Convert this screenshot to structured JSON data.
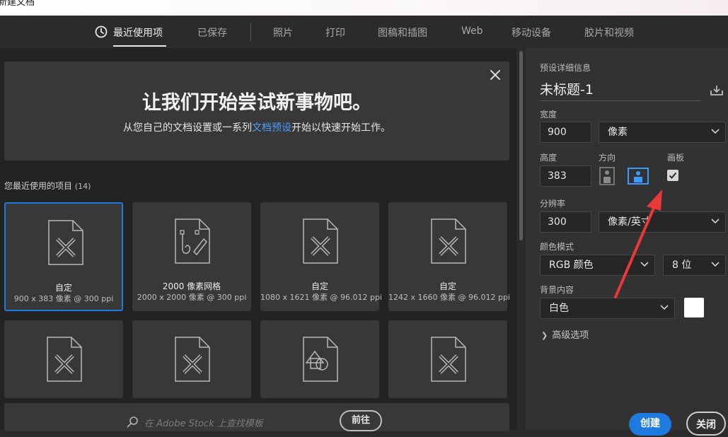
{
  "window": {
    "title": "新建文档"
  },
  "tabs": [
    {
      "label": "最近使用项",
      "active": true
    },
    {
      "label": "已保存"
    },
    {
      "label": "照片"
    },
    {
      "label": "打印"
    },
    {
      "label": "图稿和插图"
    },
    {
      "label": "Web"
    },
    {
      "label": "移动设备"
    },
    {
      "label": "胶片和视频"
    }
  ],
  "banner": {
    "title": "让我们开始尝试新事物吧。",
    "sub_before": "从您自己的文档设置或一系列",
    "sub_link": "文档预设",
    "sub_after": "开始以快速开始工作。"
  },
  "recent": {
    "label": "您最近使用的项目",
    "count": "(14)",
    "items": [
      {
        "name": "自定",
        "desc": "900 x 383 像素 @ 300 ppi",
        "icon": "pencil-ruler-doc-icon",
        "selected": true
      },
      {
        "name": "2000 像素网格",
        "desc": "2000 x 2000 像素 @ 300 ppi",
        "icon": "pen-path-doc-icon"
      },
      {
        "name": "自定",
        "desc": "1080 x 1621 像素 @ 96.012 ppi",
        "icon": "pencil-ruler-doc-icon"
      },
      {
        "name": "自定",
        "desc": "1242 x 1660 像素 @ 96.012 ppi",
        "icon": "pencil-ruler-doc-icon"
      },
      {
        "name": "",
        "desc": "",
        "icon": "pencil-ruler-doc-icon"
      },
      {
        "name": "",
        "desc": "",
        "icon": "pencil-ruler-doc-icon"
      },
      {
        "name": "",
        "desc": "",
        "icon": "shapes-doc-icon"
      },
      {
        "name": "",
        "desc": "",
        "icon": "pencil-ruler-doc-icon"
      }
    ]
  },
  "stock": {
    "placeholder": "在 Adobe Stock 上查找模板",
    "go_label": "前往"
  },
  "preset": {
    "section_label": "预设详细信息",
    "name": "未标题-1",
    "width_label": "宽度",
    "width": "900",
    "width_unit": "像素",
    "height_label": "高度",
    "height": "383",
    "orientation_label": "方向",
    "artboard_label": "画板",
    "artboard_checked": true,
    "resolution_label": "分辨率",
    "resolution": "300",
    "resolution_unit": "像素/英寸",
    "color_mode_label": "颜色模式",
    "color_mode": "RGB 颜色",
    "bit_depth": "8 位",
    "background_label": "背景内容",
    "background": "白色",
    "background_color": "#ffffff",
    "advanced_label": "高级选项"
  },
  "actions": {
    "create": "创建",
    "close": "关闭"
  },
  "colors": {
    "accent": "#1f7ae0",
    "annotation": "#e8393a",
    "link": "#4a9eff"
  }
}
